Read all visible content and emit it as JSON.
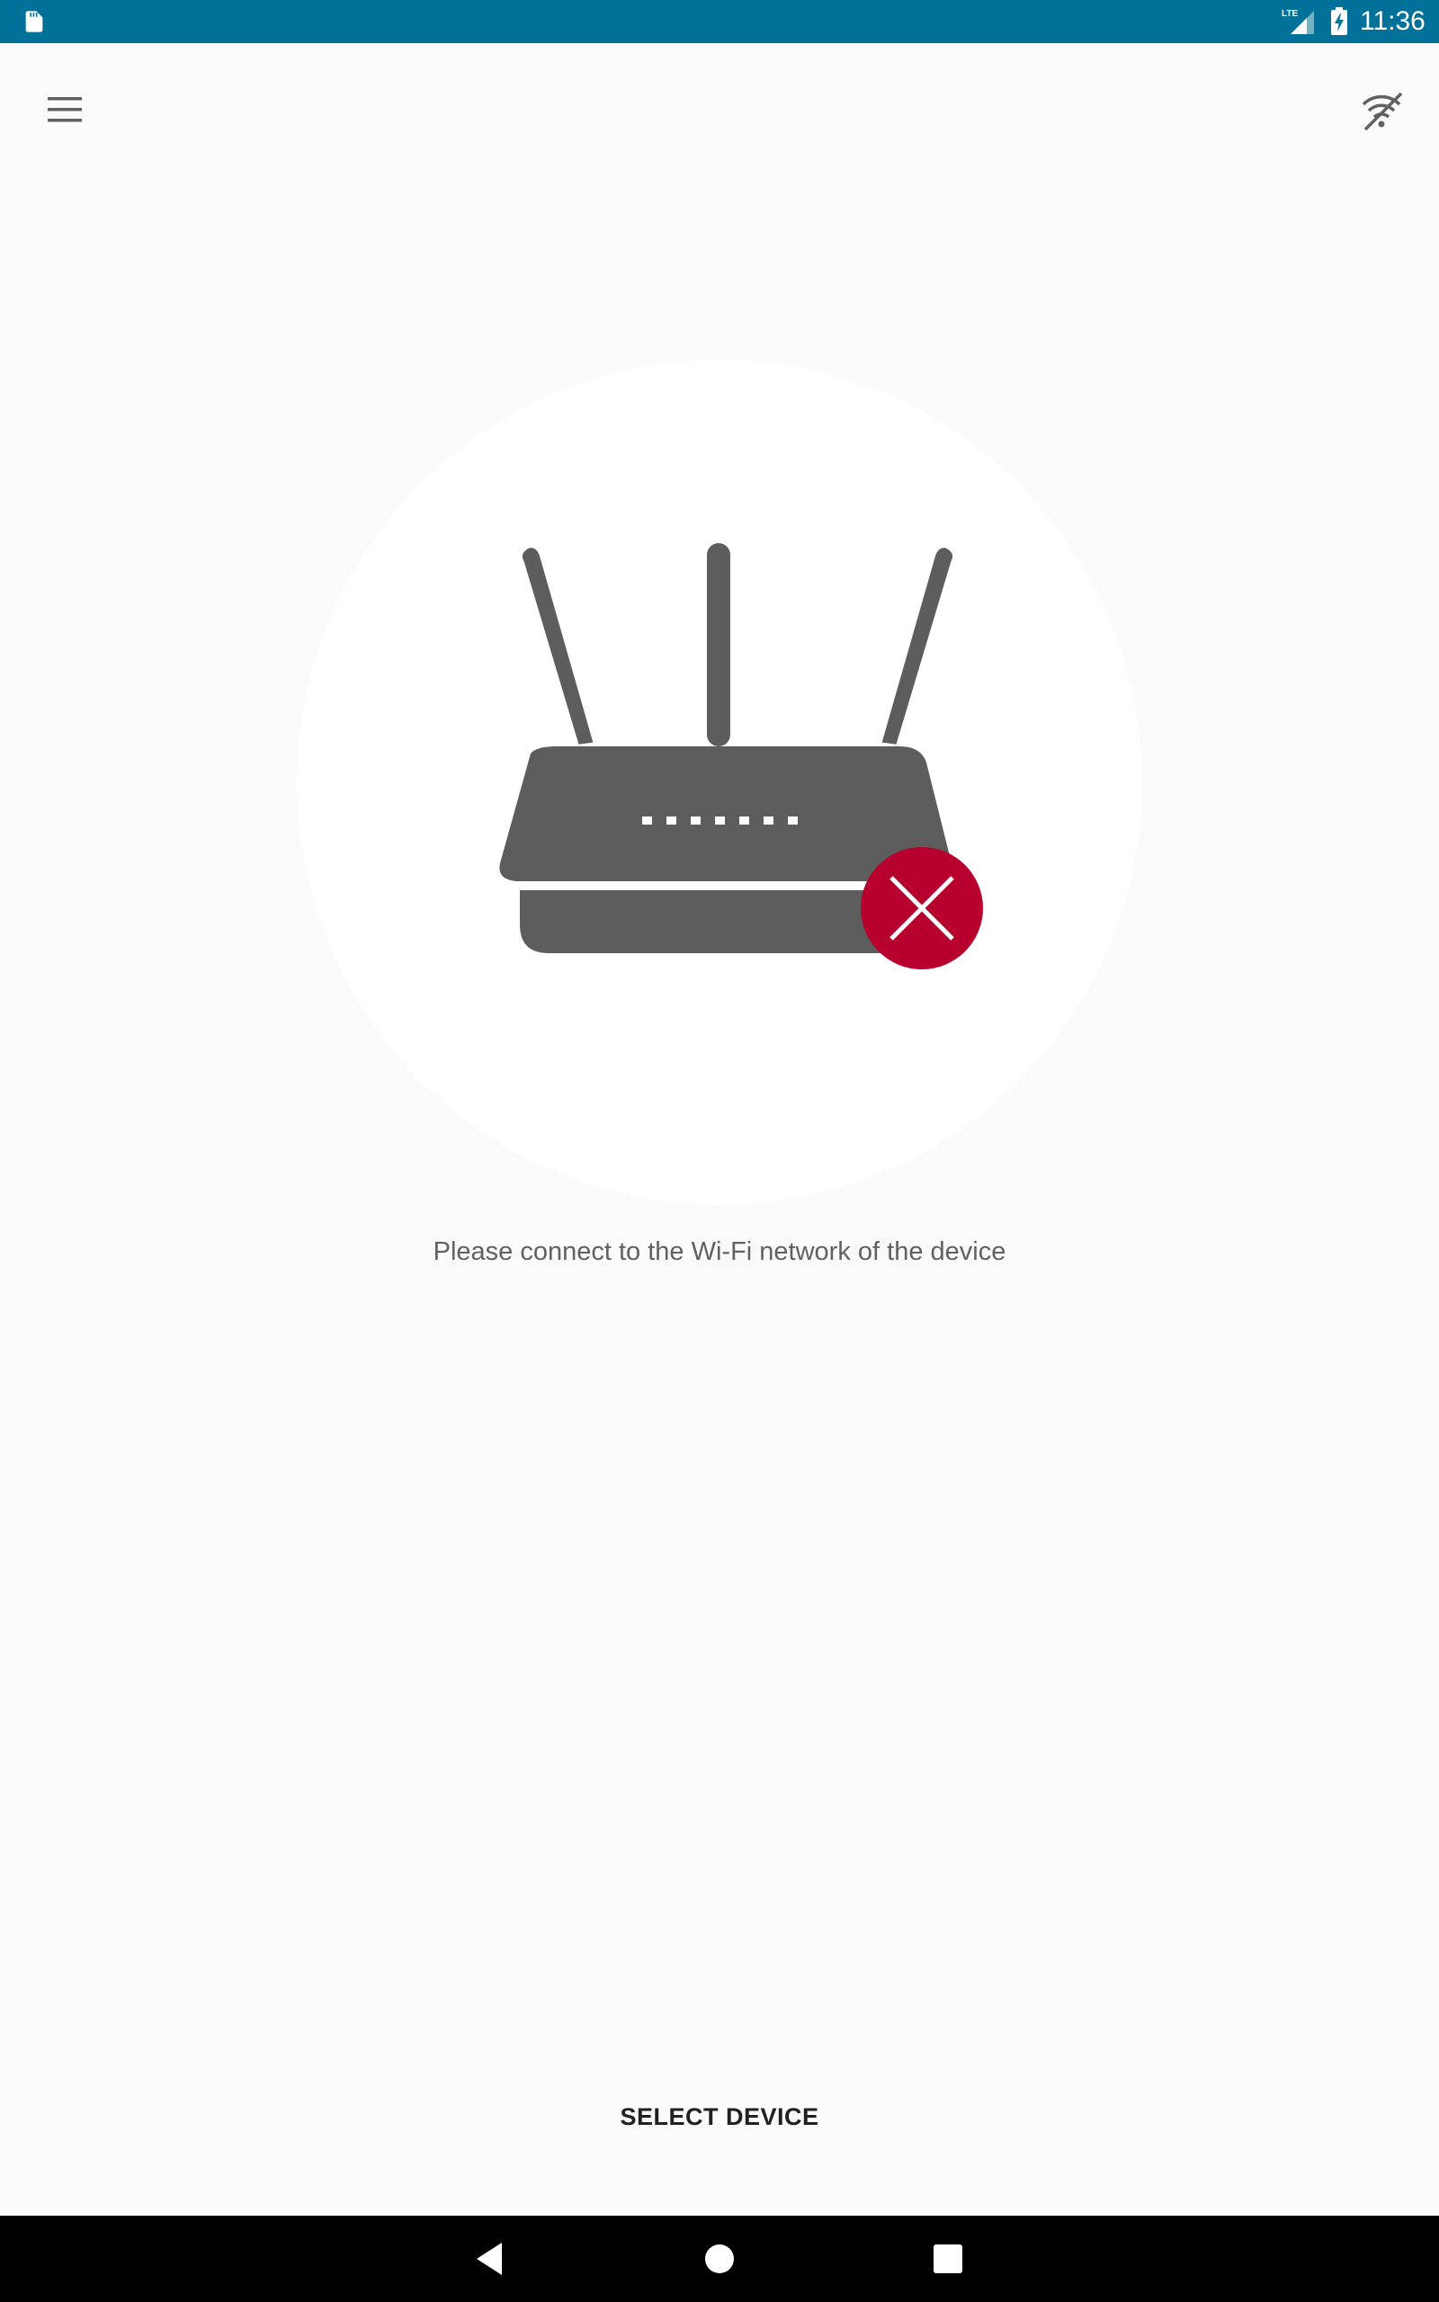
{
  "status_bar": {
    "time": "11:36",
    "network_label": "LTE",
    "icons": [
      "sd-card-icon",
      "lte-signal-icon",
      "battery-charging-icon"
    ],
    "background_color": "#00729a"
  },
  "app_bar": {
    "icons": [
      "menu-icon",
      "wifi-off-icon"
    ]
  },
  "illustration": {
    "name": "router-disconnected",
    "router_color": "#5d5d5d",
    "error_badge_color": "#b8002e"
  },
  "main": {
    "message": "Please connect to the Wi-Fi network of the device"
  },
  "actions": {
    "select_device_label": "SELECT DEVICE"
  },
  "nav_bar": {
    "icons": [
      "back-icon",
      "home-icon",
      "recents-icon"
    ]
  }
}
